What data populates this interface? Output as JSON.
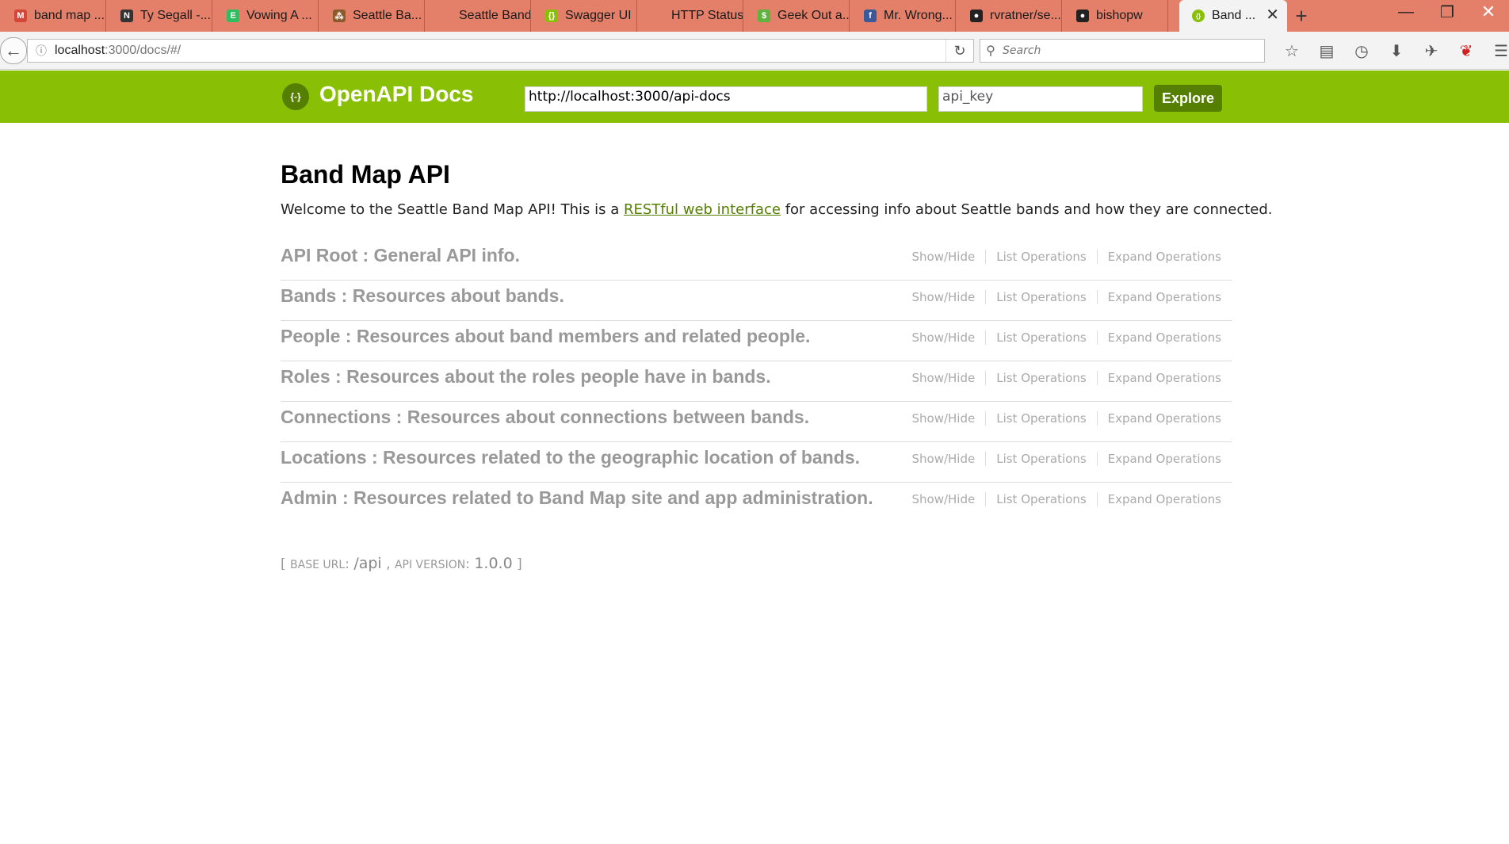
{
  "browser": {
    "tabs": [
      {
        "label": "band map ...",
        "icon": "gmail-icon",
        "color": "#d44638",
        "glyph": "M"
      },
      {
        "label": "Ty Segall -...",
        "icon": "notion-icon",
        "color": "#333333",
        "glyph": "N"
      },
      {
        "label": "Vowing A ...",
        "icon": "evernote-icon",
        "color": "#2dbe60",
        "glyph": "E"
      },
      {
        "label": "Seattle Ba...",
        "icon": "graph-icon",
        "color": "#8a5a2a",
        "glyph": "⁂"
      },
      {
        "label": "Seattle Band ...",
        "icon": "blank-page-icon",
        "color": "transparent",
        "glyph": ""
      },
      {
        "label": "Swagger UI",
        "icon": "swagger-icon",
        "color": "#89bf04",
        "glyph": "{}"
      },
      {
        "label": "HTTP Status C...",
        "icon": "blank-page-icon",
        "color": "transparent",
        "glyph": ""
      },
      {
        "label": "Geek Out a...",
        "icon": "dollar-icon",
        "color": "#5fb33f",
        "glyph": "$"
      },
      {
        "label": "Mr. Wrong...",
        "icon": "facebook-icon",
        "color": "#3b5998",
        "glyph": "f"
      },
      {
        "label": "rvratner/se...",
        "icon": "github-icon",
        "color": "#222222",
        "glyph": "●"
      },
      {
        "label": "bishopw",
        "icon": "github-icon",
        "color": "#222222",
        "glyph": "●"
      }
    ],
    "active_tab": {
      "label": "Band ...",
      "icon": "swagger-icon",
      "close": "✕"
    },
    "new_tab": "+",
    "url_host": "localhost",
    "url_rest": ":3000/docs/#/",
    "search_placeholder": "Search",
    "window_controls": {
      "minimize": "—",
      "maximize": "❐",
      "close": "✕"
    }
  },
  "swagger_header": {
    "logo_text": "OpenAPI Docs",
    "logo_glyph": "{-}",
    "spec_url": "http://localhost:3000/api-docs",
    "api_key_placeholder": "api_key",
    "explore_label": "Explore"
  },
  "api": {
    "title": "Band Map API",
    "description_before": "Welcome to the Seattle Band Map API! This is a ",
    "description_link": "RESTful web interface",
    "description_after": " for accessing info about Seattle bands and how they are connected.",
    "resources": [
      {
        "title": "API Root : General API info."
      },
      {
        "title": "Bands : Resources about bands."
      },
      {
        "title": "People : Resources about band members and related people."
      },
      {
        "title": "Roles : Resources about the roles people have in bands."
      },
      {
        "title": "Connections : Resources about connections between bands."
      },
      {
        "title": "Locations : Resources related to the geographic location of bands."
      },
      {
        "title": "Admin : Resources related to Band Map site and app administration."
      }
    ],
    "ops": {
      "show_hide": "Show/Hide",
      "list": "List Operations",
      "expand": "Expand Operations"
    },
    "footer": {
      "open": "[",
      "base_url_label": "Base URL",
      "base_url": "/api",
      "api_version_label": "API Version",
      "api_version": "1.0.0",
      "close": "]"
    }
  },
  "colors": {
    "tabstrip": "#e4806a",
    "swagger_green": "#89bf04",
    "swagger_dark_green": "#547f00"
  }
}
